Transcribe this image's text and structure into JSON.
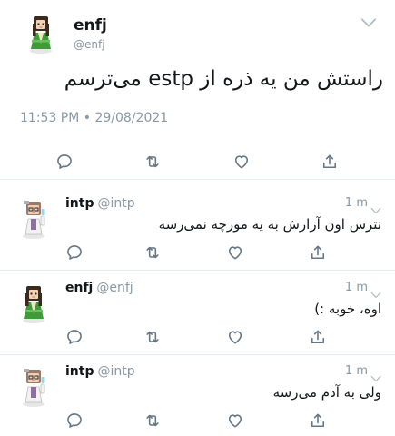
{
  "colors": {
    "text": "#14171a",
    "muted": "#8899a6",
    "divider": "#e6ecf0",
    "icon": "#657786"
  },
  "main_tweet": {
    "name": "enfj",
    "handle": "@enfj",
    "text": "راستش من یه ذره از estp می‌ترسم",
    "timestamp": "11:53 PM • 29/08/2021",
    "avatar_icon": "green-dress-character-avatar"
  },
  "replies": [
    {
      "name": "intp",
      "handle": "@intp",
      "time": "1 m",
      "text": "نترس اون آزارش به یه مورچه نمی‌رسه",
      "avatar_icon": "scientist-character-avatar"
    },
    {
      "name": "enfj",
      "handle": "@enfj",
      "time": "1 m",
      "text": "اوه، خوبه :)",
      "avatar_icon": "green-dress-character-avatar"
    },
    {
      "name": "intp",
      "handle": "@intp",
      "time": "1 m",
      "text": "ولی به آدم می‌رسه",
      "avatar_icon": "scientist-character-avatar"
    }
  ],
  "action_icons": [
    "reply-icon",
    "retweet-icon",
    "like-icon",
    "share-icon"
  ]
}
